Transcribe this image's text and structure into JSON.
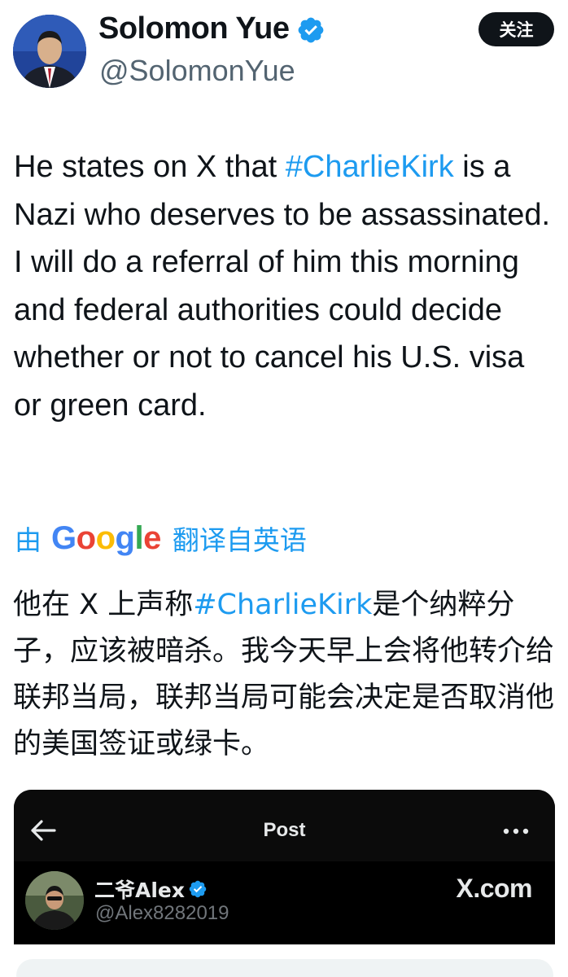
{
  "author": {
    "display_name": "Solomon Yue",
    "handle": "@SolomonYue",
    "verified_icon": "verified-badge-icon",
    "follow_label": "关注"
  },
  "tweet": {
    "text_before": "He states on X that ",
    "hashtag": "#CharlieKirk",
    "text_after": " is a Nazi who deserves to be assassinated. I will do a referral of him this morning and federal authorities could decide whether or not to cancel his U.S. visa or green card."
  },
  "translation": {
    "by": "由",
    "provider": "Google",
    "from": "翻译自英语",
    "text_before": "他在 X 上声称",
    "hashtag": "#CharlieKirk",
    "text_after": "是个纳粹分子，应该被暗杀。我今天早上会将他转介给联邦当局，联邦当局可能会决定是否取消他的美国签证或绿卡。"
  },
  "embedded_post": {
    "title": "Post",
    "display_name": "二爷Alex",
    "handle": "@Alex8282019",
    "watermark": "X.com",
    "icons": [
      "back-arrow-icon",
      "more-options-icon",
      "verified-badge-icon"
    ]
  },
  "colors": {
    "accent": "#1d9bf0",
    "text": "#0f1419",
    "muted": "#536471"
  }
}
